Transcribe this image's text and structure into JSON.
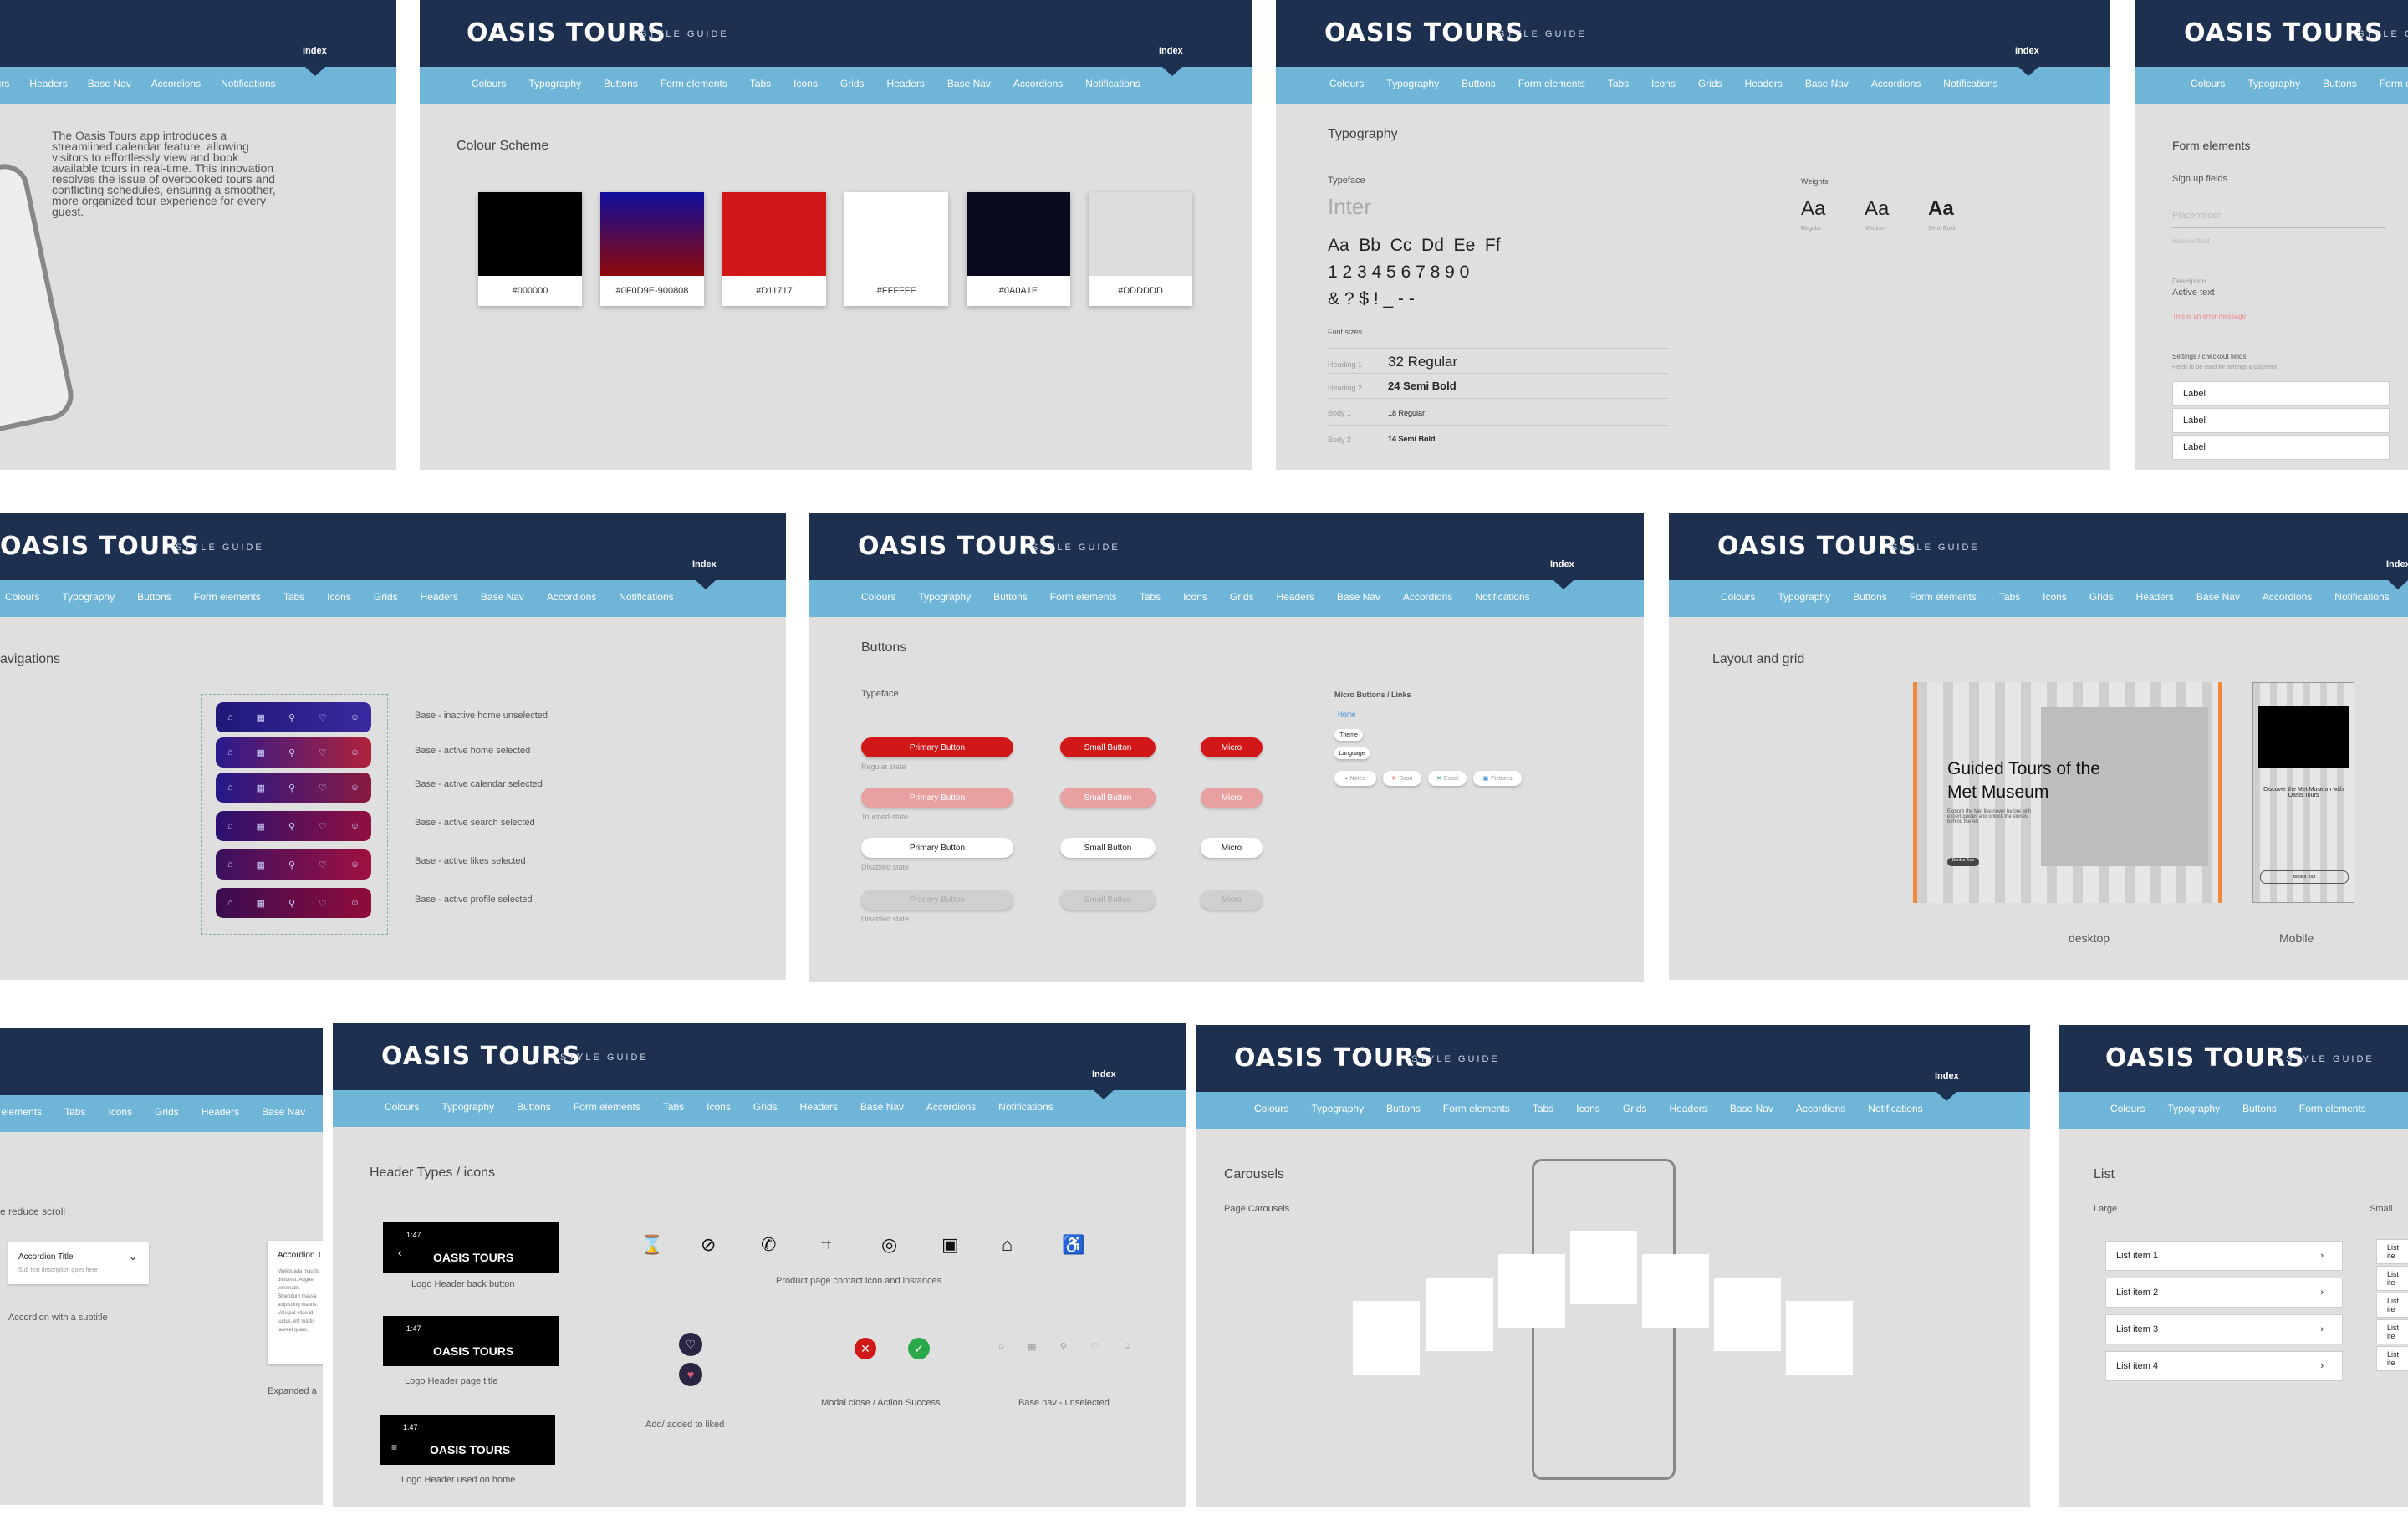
{
  "brand": {
    "logo": "OASIS TOURS",
    "subtitle": "STYLE GUIDE",
    "index": "Index"
  },
  "nav": [
    "Colours",
    "Typography",
    "Buttons",
    "Form elements",
    "Tabs",
    "Icons",
    "Grids",
    "Headers",
    "Base Nav",
    "Accordions",
    "Notifications"
  ],
  "intro": {
    "text": "The Oasis Tours app introduces a streamlined calendar feature, allowing visitors to effortlessly view and book available tours in real-time. This innovation resolves the issue of overbooked tours and conflicting schedules, ensuring a smoother, more organized tour experience for every guest."
  },
  "colours": {
    "title": "Colour Scheme",
    "swatches": [
      {
        "hex": "#000000",
        "label": "#000000"
      },
      {
        "hex": "#0F0D9E",
        "hex2": "#900808",
        "label": "#0F0D9E-900808"
      },
      {
        "hex": "#D11717",
        "label": "#D11717"
      },
      {
        "hex": "#FFFFFF",
        "label": "#FFFFFF"
      },
      {
        "hex": "#0A0A1E",
        "label": "#0A0A1E"
      },
      {
        "hex": "#DDDDDD",
        "label": "#DDDDDD"
      }
    ]
  },
  "typography": {
    "title": "Typography",
    "typeface_label": "Typeface",
    "typeface": "Inter",
    "alphabet": "Aa  Bb  Cc  Dd  Ee  Ff",
    "digits": "1 2 3 4 5 6 7 8 9 0",
    "symbols": "& ? $ ! _ - -",
    "weights_label": "Weights",
    "weights": [
      {
        "sample": "Aa",
        "name": "Regular"
      },
      {
        "sample": "Aa",
        "name": "Medium"
      },
      {
        "sample": "Aa",
        "name": "Semi Bold"
      }
    ],
    "sizes_label": "Font sizes",
    "sizes": [
      {
        "label": "Heading 1",
        "sample": "32 Regular"
      },
      {
        "label": "Heading 2",
        "sample": "24 Semi Bold"
      },
      {
        "label": "Body 1",
        "sample": "18 Regular"
      },
      {
        "label": "Body 2",
        "sample": "14 Semi Bold"
      }
    ]
  },
  "form": {
    "title": "Form elements",
    "signup": "Sign up fields",
    "placeholder": "Placeholder",
    "inactive": "Inactive field",
    "desc": "Description",
    "active": "Active text",
    "error": "This is an error message",
    "settings": "Settings / checkout fields",
    "settings_sub": "Fields to be used for settings & payment",
    "labels": [
      "Label",
      "Label",
      "Label"
    ]
  },
  "navs": {
    "title": "avigations",
    "items": [
      "Base - inactive home unselected",
      "Base - active home selected",
      "Base - active calendar selected",
      "Base - active search selected",
      "Base - active likes selected",
      "Base - active profile selected"
    ]
  },
  "buttons": {
    "title": "Buttons",
    "typeface": "Typeface",
    "primary": "Primary Button",
    "small": "Small Button",
    "micro": "Micro",
    "states": [
      "Regular state",
      "Touched state",
      "Disabled state",
      "Disabled state"
    ],
    "micro_title": "Micro Buttons / Links",
    "links": [
      "Home",
      "Theme",
      "Language"
    ],
    "tags": [
      "Notes",
      "Scan",
      "Excel",
      "Pictures"
    ]
  },
  "grid": {
    "title": "Layout and grid",
    "hero": "Guided Tours of the Met Museum",
    "hero_sub": "Explore the Met like never before with expert guides and unlock the stories behind the Art",
    "cta": "Book a Tour",
    "mobile_title": "Discover the Met Museum with Oasis Tours",
    "desktop": "desktop",
    "mobile": "Mobile"
  },
  "accordion": {
    "hint": "e reduce scroll",
    "title": "Accordion Title",
    "sub": "Sub text description goes here",
    "caption": "Accordion with a subtitle",
    "title2": "Accordion T",
    "body2": "Malesuada mauris dictumst. Augue venenatis. Bibendum massa adipiscing mauris. Volutpat vitae id luctus, elit mattis laoreet quam.",
    "caption2": "Expanded a"
  },
  "headers": {
    "title": "Header Types  / icons",
    "time": "1:47",
    "captions": [
      "Logo Header back button",
      "Logo Header page title",
      "Logo Header used on home"
    ],
    "icon_caption": "Product page contact icon and instances",
    "liked": "Add/ added to liked",
    "modal": "Modal close / Action Success",
    "basenav": "Base nav - unselected"
  },
  "carousel": {
    "title": "Carousels",
    "sub": "Page Carousels"
  },
  "list": {
    "title": "List",
    "large": "Large",
    "small": "Small",
    "items": [
      "List item 1",
      "List item 2",
      "List item 3",
      "List item 4"
    ],
    "small_items": [
      "List ite",
      "List ite",
      "List ite",
      "List ite",
      "List ite"
    ]
  }
}
